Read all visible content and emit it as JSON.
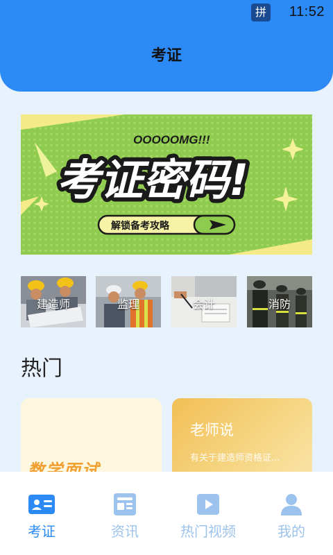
{
  "status_bar": {
    "ime_indicator": "拼",
    "time": "11:52"
  },
  "header": {
    "title": "考证"
  },
  "banner": {
    "tag_text": "OOOOOMG!!!",
    "headline": "考证密码!",
    "button_label": "解锁备考攻略",
    "colors": {
      "background": "#8fcb4f",
      "accent": "#f5f09a",
      "ink": "#1a1a1a"
    }
  },
  "categories": [
    {
      "label": "建造师",
      "icon": "construction-workers-photo"
    },
    {
      "label": "监理",
      "icon": "supervisor-photo"
    },
    {
      "label": "会计",
      "icon": "accountant-photo"
    },
    {
      "label": "消防",
      "icon": "firefighters-photo"
    }
  ],
  "hot": {
    "section_title": "热门",
    "cards": [
      {
        "art_text": "数学面试"
      },
      {
        "title": "老师说",
        "subtitle": "有关于建造师资格证..."
      }
    ]
  },
  "bottom_nav": {
    "active_index": 0,
    "items": [
      {
        "label": "考证",
        "icon": "id-card-icon"
      },
      {
        "label": "资讯",
        "icon": "news-icon"
      },
      {
        "label": "热门视频",
        "icon": "video-play-icon"
      },
      {
        "label": "我的",
        "icon": "user-icon"
      }
    ]
  },
  "colors": {
    "primary": "#2b8af5",
    "page_background": "#e8f2fd",
    "nav_inactive": "#9cc3ee"
  }
}
